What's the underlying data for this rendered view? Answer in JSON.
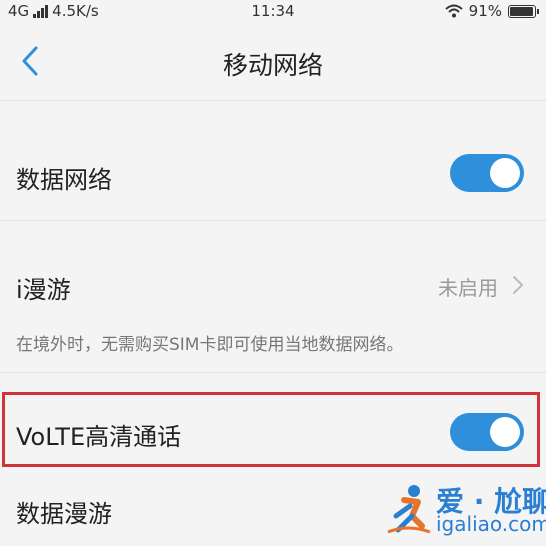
{
  "status_bar": {
    "network": "4G",
    "speed": "4.5K/s",
    "time": "11:34",
    "battery": "91%",
    "icons": [
      "signal-icon",
      "wifi-icon",
      "battery-icon"
    ]
  },
  "nav": {
    "title": "移动网络",
    "back_icon": "chevron-left-icon"
  },
  "settings": {
    "data_network": {
      "label": "数据网络",
      "enabled": true
    },
    "roaming": {
      "label": "i漫游",
      "value": "未启用",
      "hint": "在境外时，无需购买SIM卡即可使用当地数据网络。"
    },
    "volte": {
      "label": "VoLTE高清通话",
      "enabled": true
    },
    "data_roaming": {
      "label": "数据漫游"
    }
  },
  "watermark": {
    "title": "爱 · 尬聊",
    "url": "igaliao.com"
  },
  "colors": {
    "toggle_on": "#2e8fdb",
    "highlight": "#d2333a",
    "accent": "#2b7fd3"
  }
}
